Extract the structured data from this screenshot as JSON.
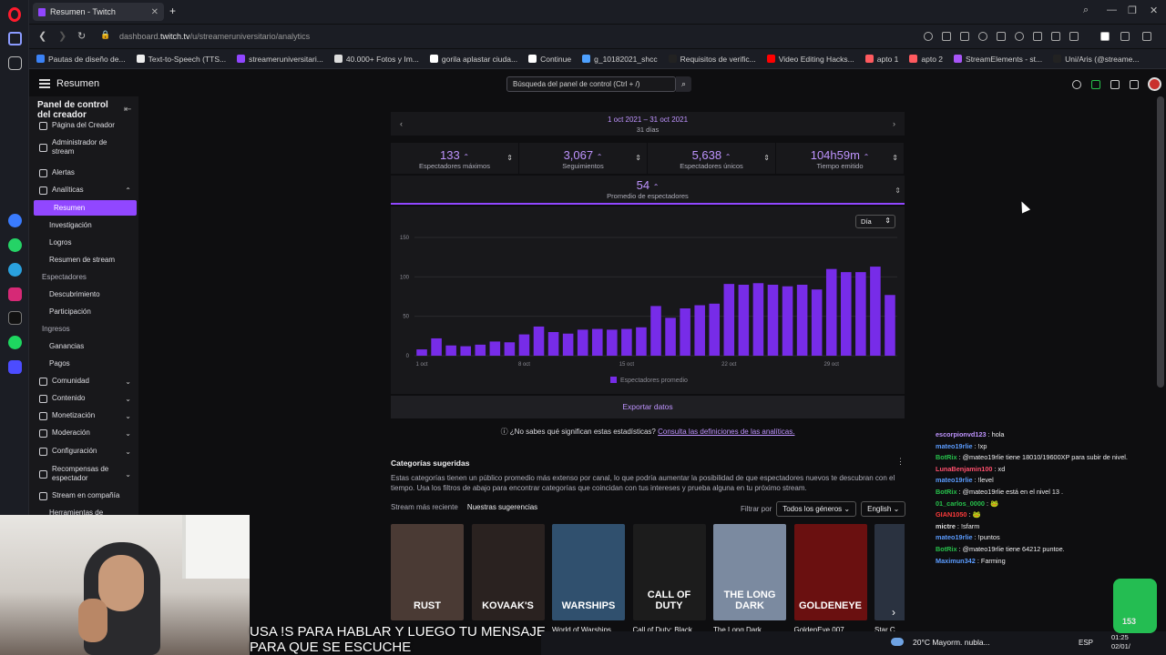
{
  "browser": {
    "tab_title": "Resumen - Twitch",
    "url_prefix": "dashboard.",
    "url_domain": "twitch.tv",
    "url_path": "/u/streameruniversitario/analytics",
    "bookmarks": [
      {
        "label": "Pautas de diseño de...",
        "color": "#3b82f6"
      },
      {
        "label": "Text-to-Speech (TTS...",
        "color": "#eeeeee"
      },
      {
        "label": "streameruniversitari...",
        "color": "#9146ff"
      },
      {
        "label": "40.000+ Fotos y Im...",
        "color": "#dddddd"
      },
      {
        "label": "gorila aplastar ciuda...",
        "color": "#ffffff"
      },
      {
        "label": "Continue",
        "color": "#ffffff"
      },
      {
        "label": "g_10182021_shcc",
        "color": "#4ea1ff"
      },
      {
        "label": "Requisitos de verific...",
        "color": "#222222"
      },
      {
        "label": "Video Editing Hacks...",
        "color": "#ff0000"
      },
      {
        "label": "apto 1",
        "color": "#ff5a5f"
      },
      {
        "label": "apto 2",
        "color": "#ff5a5f"
      },
      {
        "label": "StreamElements - st...",
        "color": "#a855f7"
      },
      {
        "label": "Uni/Aris (@streame...",
        "color": "#222222"
      }
    ]
  },
  "header": {
    "title": "Resumen",
    "search_placeholder": "Búsqueda del panel de control (Ctrl + /)"
  },
  "sidebar": {
    "title": "Panel de control del creador",
    "items": [
      {
        "label": "Página del Creador"
      },
      {
        "label": "Administrador de stream"
      },
      {
        "label": "Alertas"
      },
      {
        "label": "Analíticas"
      },
      {
        "label": "Resumen"
      },
      {
        "label": "Investigación"
      },
      {
        "label": "Logros"
      },
      {
        "label": "Resumen de stream"
      },
      {
        "label": "Espectadores"
      },
      {
        "label": "Descubrimiento"
      },
      {
        "label": "Participación"
      },
      {
        "label": "Ingresos"
      },
      {
        "label": "Ganancias"
      },
      {
        "label": "Pagos"
      },
      {
        "label": "Comunidad"
      },
      {
        "label": "Contenido"
      },
      {
        "label": "Monetización"
      },
      {
        "label": "Moderación"
      },
      {
        "label": "Configuración"
      },
      {
        "label": "Recompensas de espectador"
      },
      {
        "label": "Stream en compañía"
      },
      {
        "label": "Herramientas de"
      }
    ]
  },
  "analytics": {
    "date_range": "1 oct 2021 – 31 oct 2021",
    "days": "31 días",
    "stats": [
      {
        "value": "133",
        "label": "Espectadores máximos"
      },
      {
        "value": "3,067",
        "label": "Seguimientos"
      },
      {
        "value": "5,638",
        "label": "Espectadores únicos"
      },
      {
        "value": "104h59m",
        "label": "Tiempo emitido"
      }
    ],
    "avg_value": "54",
    "avg_label": "Promedio de espectadores",
    "period": "Día",
    "export": "Exportar datos",
    "help_text": "¿No sabes qué significan estas estadísticas?",
    "help_link": "Consulta las definiciones de las analíticas."
  },
  "chart_data": {
    "type": "bar",
    "ylim": [
      0,
      150
    ],
    "yticks": [
      "0",
      "50",
      "100",
      "150"
    ],
    "xticks": [
      "1 oct",
      "8 oct",
      "15 oct",
      "22 oct",
      "29 oct"
    ],
    "xtick_index": [
      0,
      7,
      14,
      21,
      28
    ],
    "legend": "Espectadores promedio",
    "bar_color": "#772ce8",
    "values": [
      8,
      22,
      13,
      12,
      14,
      18,
      17,
      27,
      37,
      30,
      28,
      33,
      34,
      33,
      34,
      36,
      63,
      48,
      60,
      64,
      66,
      91,
      90,
      92,
      90,
      88,
      90,
      84,
      110,
      106,
      106,
      113,
      77
    ]
  },
  "categories": {
    "title": "Categorías sugeridas",
    "description": "Estas categorías tienen un público promedio más extenso por canal, lo que podría aumentar la posibilidad de que espectadores nuevos te descubran con el tiempo. Usa los filtros de abajo para encontrar categorías que coincidan con tus intereses y prueba alguna en tu próximo stream.",
    "tab_recent": "Stream más reciente",
    "tab_suggestions": "Nuestras sugerencias",
    "filter_label": "Filtrar por",
    "genre": "Todos los géneros",
    "language": "English",
    "cards": [
      {
        "name": "",
        "art": "RUST",
        "bg": "#4a3a34"
      },
      {
        "name": "",
        "art": "KOVAAK'S",
        "bg": "#2a2220"
      },
      {
        "name": "World of Warships",
        "art": "WARSHIPS",
        "bg": "#30506e"
      },
      {
        "name": "Call of Duty: Black ...",
        "art": "CALL OF DUTY",
        "bg": "#1c1c1c"
      },
      {
        "name": "The Long Dark",
        "art": "THE LONG DARK",
        "bg": "#7b8aa0"
      },
      {
        "name": "GoldenEye 007",
        "art": "GOLDENEYE",
        "bg": "#6a1010"
      },
      {
        "name": "Star C",
        "art": "",
        "bg": "#2a3240"
      }
    ]
  },
  "chat": [
    {
      "user": "escorpionvd123",
      "color": "#bf94ff",
      "msg": "hola"
    },
    {
      "user": "mateo19rlie",
      "color": "#5b9cff",
      "msg": "!xp"
    },
    {
      "user": "BotRix",
      "color": "#27c24c",
      "msg": "@mateo19rlie tiene 18010/19600XP para subir de nivel."
    },
    {
      "user": "LunaBenjamin100",
      "color": "#ff4f6d",
      "msg": "xd"
    },
    {
      "user": "mateo19rlie",
      "color": "#5b9cff",
      "msg": "!level"
    },
    {
      "user": "BotRix",
      "color": "#27c24c",
      "msg": "@mateo19rlie está en el nivel 13 ."
    },
    {
      "user": "01_carlos_0000",
      "color": "#27c24c",
      "msg": "🐸"
    },
    {
      "user": "GIAN1050",
      "color": "#ff3b3b",
      "msg": "🐸"
    },
    {
      "user": "mictre",
      "color": "#dddddd",
      "msg": "!sfarm"
    },
    {
      "user": "mateo19rlie",
      "color": "#5b9cff",
      "msg": "!puntos"
    },
    {
      "user": "BotRix",
      "color": "#27c24c",
      "msg": "@mateo19rlie tiene 64212 puntoe."
    },
    {
      "user": "Maximun342",
      "color": "#5b9cff",
      "msg": "Farming"
    }
  ],
  "overlay": {
    "subtitle_line1": "USA !S PARA HABLAR Y LUEGO TU MENSAJE",
    "subtitle_line2": "PARA QUE SE ESCUCHE",
    "badge": "153"
  },
  "taskbar": {
    "weather": "20°C  Mayorm. nubla...",
    "lang": "ESP",
    "time": "01:25",
    "date": "02/01/"
  }
}
